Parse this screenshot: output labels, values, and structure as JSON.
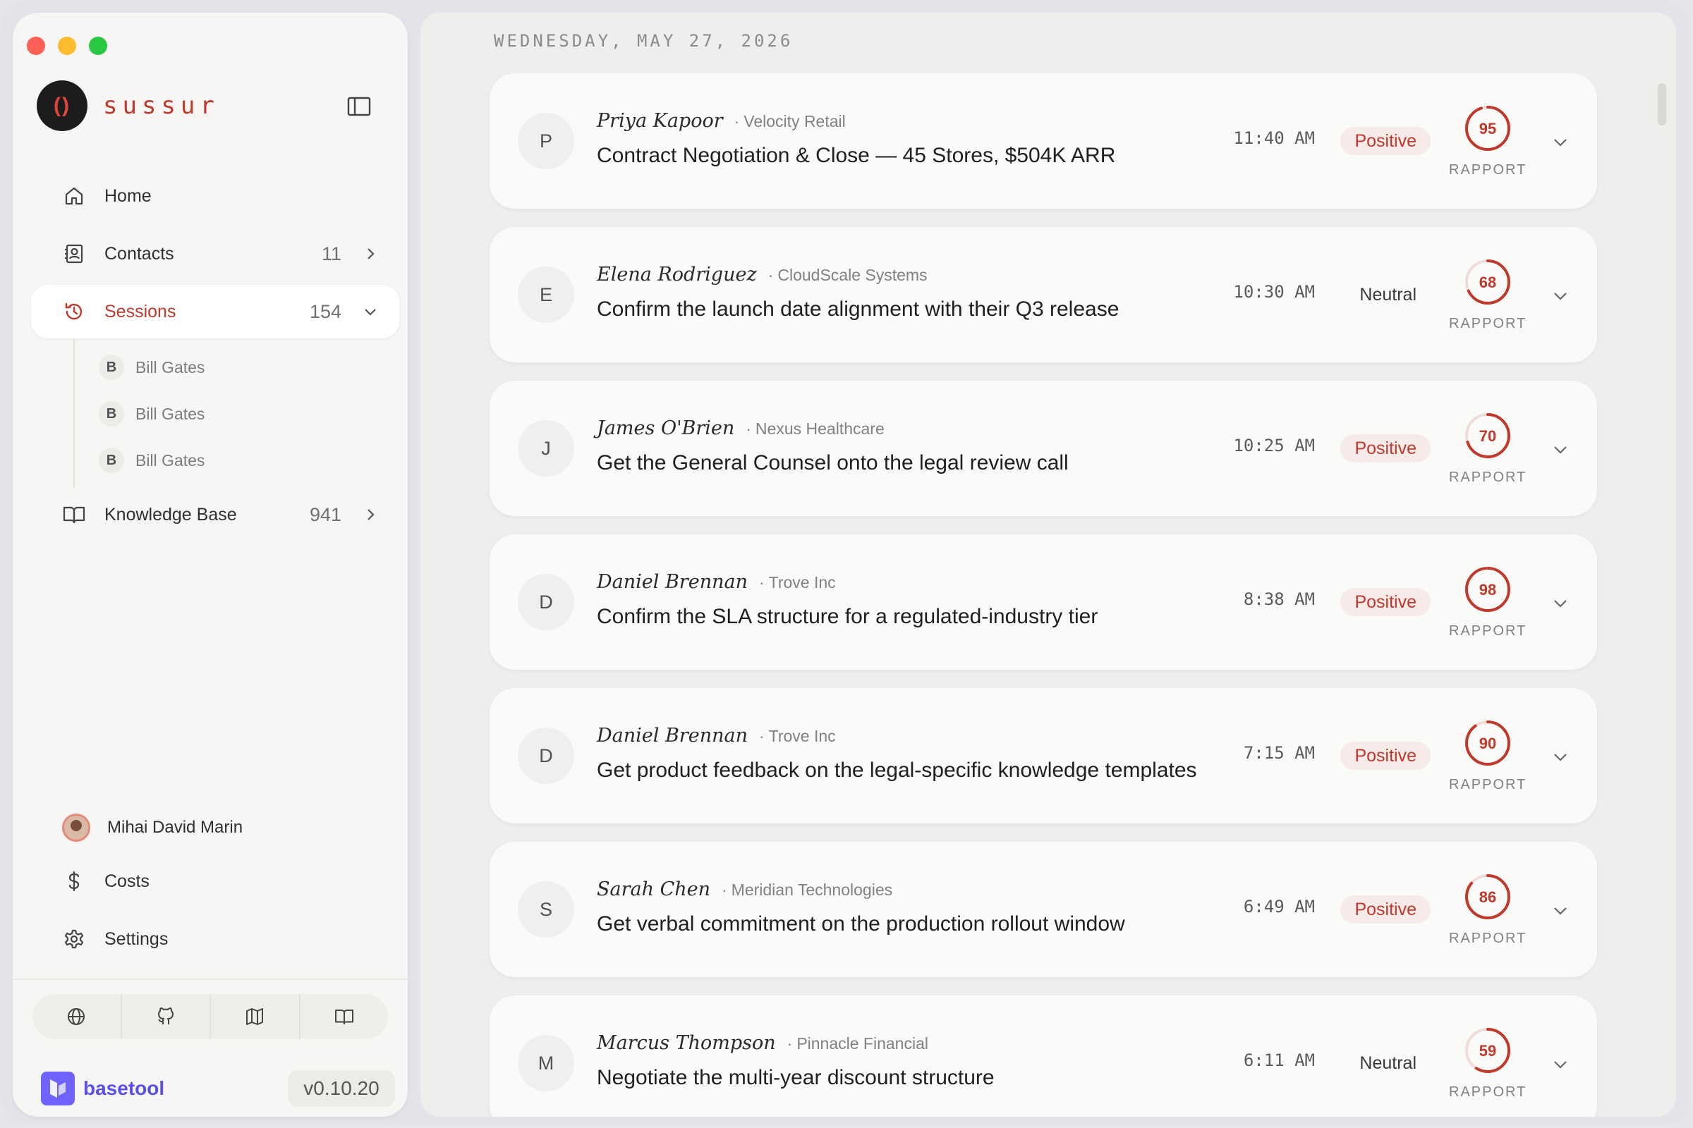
{
  "app": {
    "name": "sussur",
    "logo_glyph": "()"
  },
  "nav": {
    "home": "Home",
    "contacts": {
      "label": "Contacts",
      "count": "11"
    },
    "sessions": {
      "label": "Sessions",
      "count": "154",
      "children": [
        {
          "initial": "B",
          "label": "Bill Gates"
        },
        {
          "initial": "B",
          "label": "Bill Gates"
        },
        {
          "initial": "B",
          "label": "Bill Gates"
        }
      ]
    },
    "knowledge": {
      "label": "Knowledge Base",
      "count": "941"
    }
  },
  "footer": {
    "user": "Mihai David Marin",
    "costs": "Costs",
    "settings": "Settings",
    "iconbar": [
      "globe-icon",
      "github-icon",
      "map-icon",
      "book-icon"
    ],
    "vendor": "basetool",
    "version": "v0.10.20"
  },
  "main": {
    "date": "WEDNESDAY, MAY 27, 2026",
    "rapport_label": "RAPPORT",
    "sessions": [
      {
        "initial": "P",
        "name": "Priya Kapoor",
        "company": "Velocity Retail",
        "title": "Contract Negotiation & Close — 45 Stores, $504K ARR",
        "time": "11:40 AM",
        "sentiment": "Positive",
        "rapport": "95"
      },
      {
        "initial": "E",
        "name": "Elena Rodriguez",
        "company": "CloudScale Systems",
        "title": "Confirm the launch date alignment with their Q3 release",
        "time": "10:30 AM",
        "sentiment": "Neutral",
        "rapport": "68"
      },
      {
        "initial": "J",
        "name": "James O'Brien",
        "company": "Nexus Healthcare",
        "title": "Get the General Counsel onto the legal review call",
        "time": "10:25 AM",
        "sentiment": "Positive",
        "rapport": "70"
      },
      {
        "initial": "D",
        "name": "Daniel Brennan",
        "company": "Trove Inc",
        "title": "Confirm the SLA structure for a regulated-industry tier",
        "time": "8:38 AM",
        "sentiment": "Positive",
        "rapport": "98"
      },
      {
        "initial": "D",
        "name": "Daniel Brennan",
        "company": "Trove Inc",
        "title": "Get product feedback on the legal-specific knowledge templates",
        "time": "7:15 AM",
        "sentiment": "Positive",
        "rapport": "90"
      },
      {
        "initial": "S",
        "name": "Sarah Chen",
        "company": "Meridian Technologies",
        "title": "Get verbal commitment on the production rollout window",
        "time": "6:49 AM",
        "sentiment": "Positive",
        "rapport": "86"
      },
      {
        "initial": "M",
        "name": "Marcus Thompson",
        "company": "Pinnacle Financial",
        "title": "Negotiate the multi-year discount structure",
        "time": "6:11 AM",
        "sentiment": "Neutral",
        "rapport": "59"
      }
    ]
  },
  "colors": {
    "accent": "#c0392b",
    "ring_track": "#f0dcd9",
    "vendor": "#6f63ff"
  }
}
